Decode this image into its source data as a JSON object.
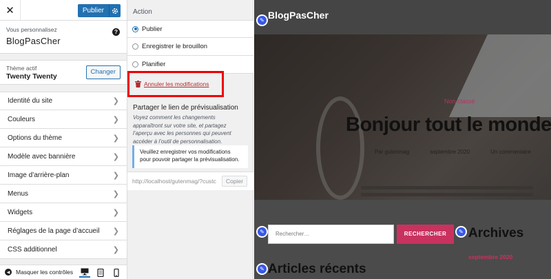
{
  "sidebar": {
    "close_icon": "close-icon",
    "publish_label": "Publier",
    "gear_icon": "gear-icon",
    "customizing_label": "Vous personnalisez",
    "site_name": "BlogPasCher",
    "help_icon": "help-icon",
    "theme_label": "Thème actif",
    "theme_name": "Twenty Twenty",
    "change_label": "Changer",
    "menu": [
      {
        "label": "Identité du site"
      },
      {
        "label": "Couleurs"
      },
      {
        "label": "Options du thème"
      },
      {
        "label": "Modèle avec bannière"
      },
      {
        "label": "Image d’arrière-plan"
      },
      {
        "label": "Menus"
      },
      {
        "label": "Widgets"
      },
      {
        "label": "Réglages de la page d’accueil"
      },
      {
        "label": "CSS additionnel"
      }
    ],
    "hide_controls_label": "Masquer les contrôles",
    "devices": [
      "desktop-icon",
      "tablet-icon",
      "mobile-icon"
    ]
  },
  "publish_settings": {
    "action_title": "Action",
    "options": [
      {
        "label": "Publier",
        "selected": true
      },
      {
        "label": "Enregistrer le brouillon",
        "selected": false
      },
      {
        "label": "Planifier",
        "selected": false
      }
    ],
    "discard_label": "Annuler les modifications",
    "share_title": "Partager le lien de prévisualisation",
    "share_description": "Voyez comment les changements apparaîtront sur votre site, et partagez l’aperçu avec les personnes qui peuvent accéder à l’outil de personnalisation.",
    "notice_text": "Veuillez enregistrer vos modifications pour pouvoir partager la prévisualisation.",
    "preview_url": "http://localhost/gutenmag/?custc",
    "copy_label": "Copier"
  },
  "preview": {
    "site_title": "BlogPasCher",
    "category": "Non classé",
    "post_title": "Bonjour tout le monde !",
    "author": "Par gutenmag",
    "date": "septembre 2020",
    "comments": "Un commentaire",
    "search_placeholder": "Rechercher…",
    "search_button": "RECHERCHER",
    "archives_title": "Archives",
    "archive_month": "septembre 2020",
    "recent_title": "Articles récents"
  },
  "colors": {
    "accent": "#2271b1",
    "danger": "#b32d2e",
    "highlight_box": "#ee0000",
    "preview_pink": "#c9325f"
  }
}
